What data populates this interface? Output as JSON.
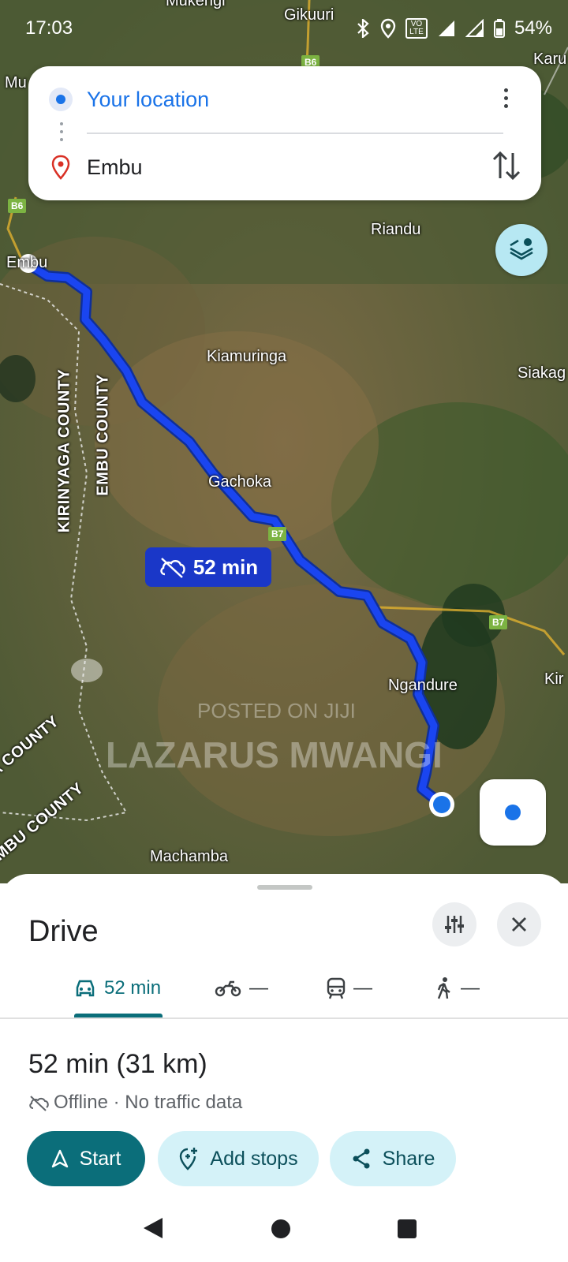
{
  "status": {
    "time": "17:03",
    "battery": "54%",
    "volte": "VO LTE"
  },
  "search": {
    "origin": "Your location",
    "destination": "Embu"
  },
  "map": {
    "labels": {
      "gikuuri": "Gikuuri",
      "mukengi": "Mukengi",
      "mu": "Mu",
      "karu": "Karu",
      "riandu": "Riandu",
      "embu": "Embu",
      "kiamuringa": "Kiamuringa",
      "siakago": "Siakag",
      "gachoka": "Gachoka",
      "ngandure": "Ngandure",
      "kir": "Kir",
      "machamba": "Machamba"
    },
    "counties": {
      "kirinyaga": "KIRINYAGA COUNTY",
      "embu": "EMBU COUNTY",
      "a_county": "A COUNTY",
      "mbu_county": "MBU COUNTY"
    },
    "road_shields": {
      "b6_top": "B6",
      "b6_left": "B6",
      "b7_mid": "B7",
      "b7_right": "B7"
    },
    "eta_badge": "52 min",
    "watermark": {
      "line1": "POSTED ON JIJI",
      "line2": "LAZARUS MWANGI"
    }
  },
  "sheet": {
    "title": "Drive",
    "modes": [
      {
        "icon": "car-icon",
        "label": "52 min",
        "active": true
      },
      {
        "icon": "motorcycle-icon",
        "label": "—",
        "active": false
      },
      {
        "icon": "transit-icon",
        "label": "—",
        "active": false
      },
      {
        "icon": "walking-icon",
        "label": "—",
        "active": false
      }
    ],
    "summary": "52 min (31 km)",
    "traffic_note": "Offline · No traffic data",
    "buttons": {
      "start": "Start",
      "add_stops": "Add stops",
      "share": "Share"
    }
  },
  "colors": {
    "accent": "#0b6e7a",
    "route": "#1a37c8",
    "link": "#1a73e8"
  }
}
